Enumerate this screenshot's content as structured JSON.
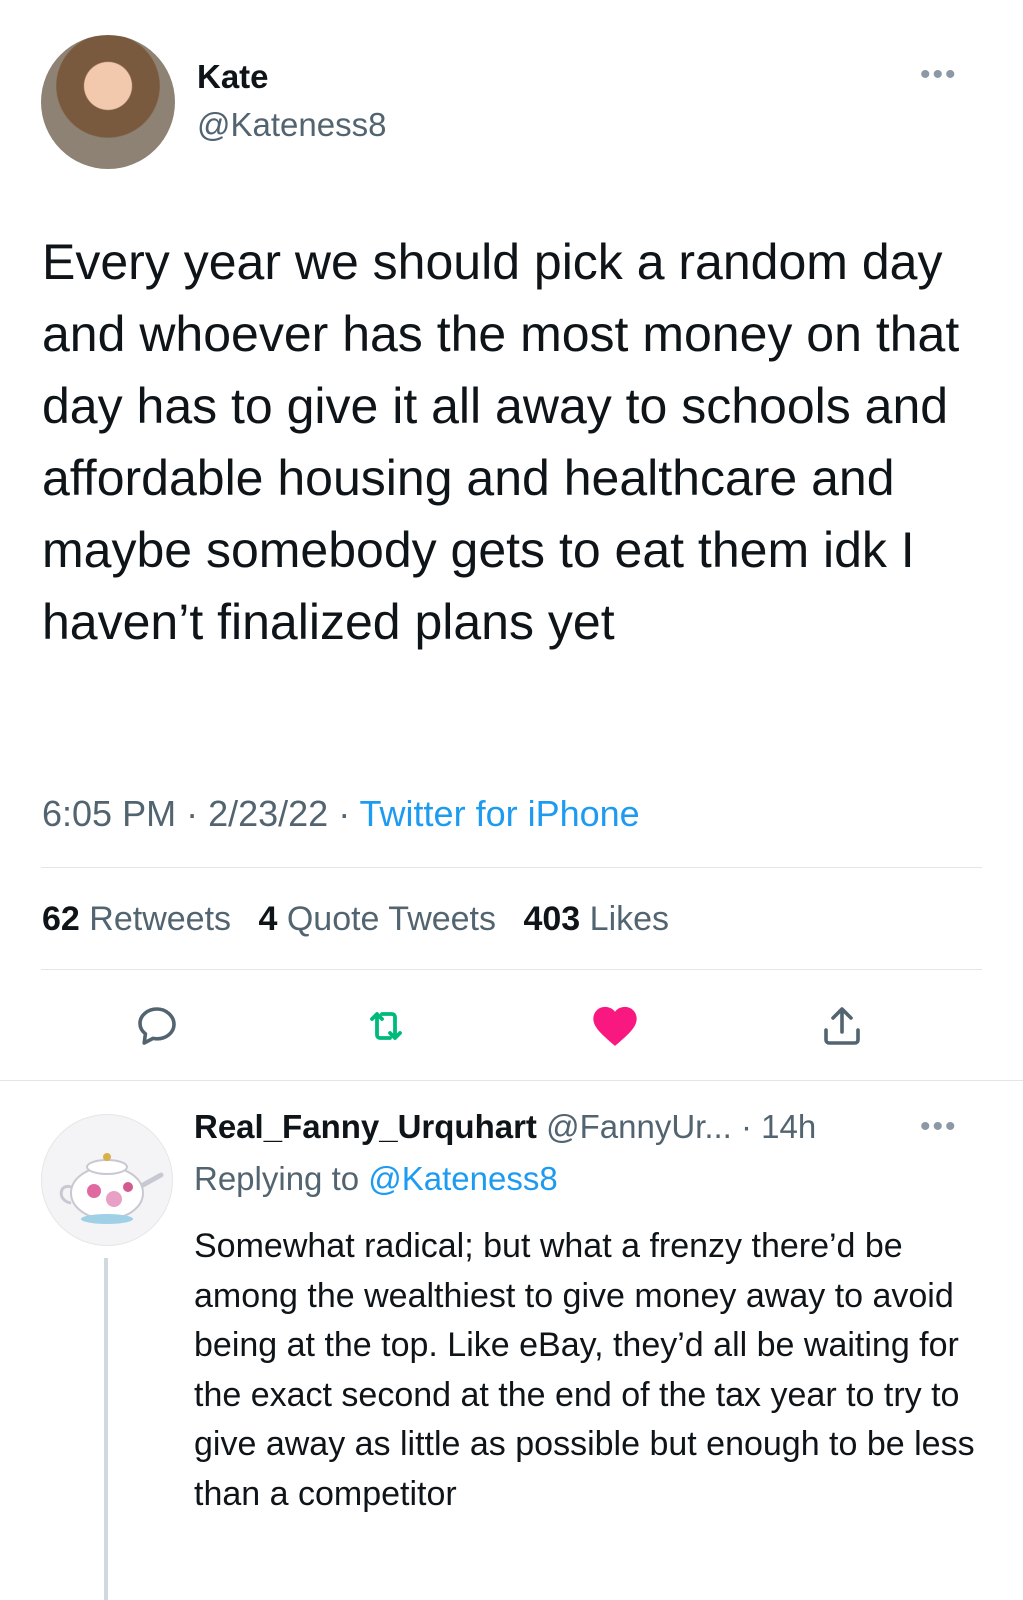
{
  "tweet": {
    "author_name": "Kate",
    "author_handle": "@Kateness8",
    "more_label": "•••",
    "text": "Every year we should pick a random day and whoever has the most money on that day has to give it all away to schools and affordable housing and healthcare and maybe somebody gets to eat them idk I haven’t finalized plans yet",
    "time": "6:05 PM",
    "date": "2/23/22",
    "separator": " · ",
    "source": "Twitter for iPhone",
    "stats": {
      "retweets_count": "62",
      "retweets_label": "Retweets",
      "quote_count": "4",
      "quote_label": "Quote Tweets",
      "likes_count": "403",
      "likes_label": "Likes"
    },
    "actions": {
      "reply_icon": "reply-icon",
      "retweet_icon": "retweet-icon",
      "like_icon": "heart-icon",
      "share_icon": "share-icon"
    }
  },
  "reply": {
    "author_name": "Real_Fanny_Urquhart",
    "author_handle": "@FannyUr...",
    "separator": " · ",
    "age": "14h",
    "more_label": "•••",
    "replying_prefix": "Replying to ",
    "replying_handle": "@Kateness8",
    "text": "Somewhat radical; but what a frenzy there’d be among the wealthiest to give money away to avoid being at the top. Like eBay, they’d all be waiting for the exact second at the end of the tax year to try to give away as little as possible but enough to be less than a competitor"
  },
  "colors": {
    "text_primary": "#0f1419",
    "text_secondary": "#536471",
    "link": "#1d9bf0",
    "retweet_green": "#00ba7c",
    "like_pink": "#f91880",
    "divider": "#e1e6ea"
  }
}
